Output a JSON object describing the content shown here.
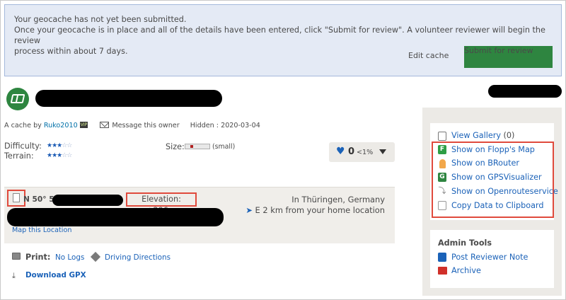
{
  "banner": {
    "line1": "Your geocache has not yet been submitted.",
    "line2": "Once your geocache is in place and all of the details have been entered, click \"Submit for review\". A volunteer reviewer will begin the review",
    "line3": "process within about 7 days.",
    "edit_label": "Edit cache",
    "submit_label": "Submit for review"
  },
  "cache": {
    "by_prefix": "A cache by",
    "owner": "Ruko2010",
    "owner_badge": "VIP",
    "message_owner": "Message this owner",
    "hidden": "Hidden : 2020-03-04",
    "difficulty_label": "Difficulty:",
    "terrain_label": "Terrain:",
    "difficulty_stars": 2.5,
    "terrain_stars": 3,
    "size_label": "Size:",
    "size_value": "(small)",
    "favorites_count": "0",
    "favorites_pct": "<1%"
  },
  "location": {
    "coord_prefix": "N 50° 5",
    "elevation": "Elevation: +296m",
    "region": "In Thüringen, Germany",
    "distance": "E 2 km from your home location",
    "map_link": "Map this Location"
  },
  "actions": {
    "print_label": "Print:",
    "no_logs": "No Logs",
    "driving": "Driving Directions",
    "download_gpx": "Download GPX"
  },
  "sidebar": {
    "gallery": "View Gallery",
    "gallery_count": "(0)",
    "flopp": "Show on Flopp's Map",
    "brouter": "Show on BRouter",
    "gpsvisualizer": "Show on GPSVisualizer",
    "openroute": "Show on Openrouteservice",
    "clipboard": "Copy Data to Clipboard",
    "admin_title": "Admin Tools",
    "reviewer_note": "Post Reviewer Note",
    "archive": "Archive"
  },
  "colors": {
    "accent_green": "#2e8540",
    "link_blue": "#1b62b8",
    "highlight_red": "#e04a3c",
    "banner_bg": "#e4eaf5"
  }
}
